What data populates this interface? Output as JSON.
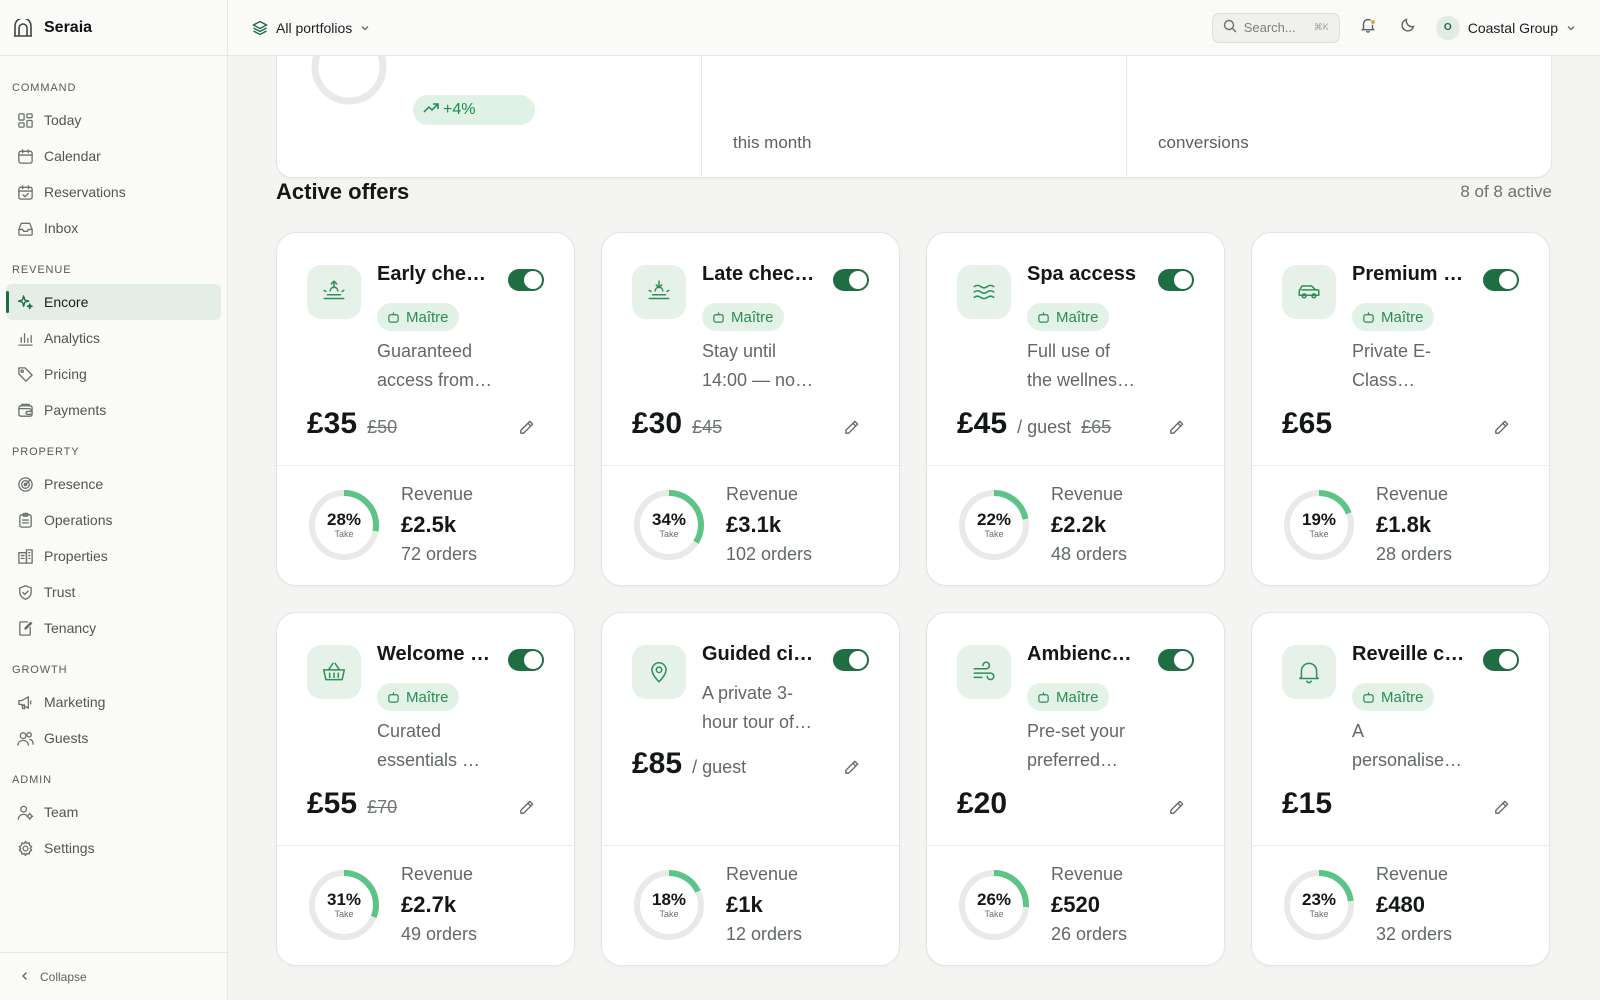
{
  "app": {
    "name": "Seraia"
  },
  "sidebar": {
    "sections": [
      {
        "heading": "COMMAND",
        "items": [
          {
            "label": "Today",
            "icon": "grid-icon"
          },
          {
            "label": "Calendar",
            "icon": "calendar-icon"
          },
          {
            "label": "Reservations",
            "icon": "calendar-check-icon"
          },
          {
            "label": "Inbox",
            "icon": "inbox-icon"
          }
        ]
      },
      {
        "heading": "REVENUE",
        "items": [
          {
            "label": "Encore",
            "icon": "sparkles-icon",
            "active": true
          },
          {
            "label": "Analytics",
            "icon": "bar-chart-icon"
          },
          {
            "label": "Pricing",
            "icon": "tag-icon"
          },
          {
            "label": "Payments",
            "icon": "wallet-icon"
          }
        ]
      },
      {
        "heading": "PROPERTY",
        "items": [
          {
            "label": "Presence",
            "icon": "radar-icon"
          },
          {
            "label": "Operations",
            "icon": "clipboard-icon"
          },
          {
            "label": "Properties",
            "icon": "building-icon"
          },
          {
            "label": "Trust",
            "icon": "shield-icon"
          },
          {
            "label": "Tenancy",
            "icon": "file-edit-icon"
          }
        ]
      },
      {
        "heading": "GROWTH",
        "items": [
          {
            "label": "Marketing",
            "icon": "megaphone-icon"
          },
          {
            "label": "Guests",
            "icon": "users-icon"
          }
        ]
      },
      {
        "heading": "ADMIN",
        "items": [
          {
            "label": "Team",
            "icon": "user-cog-icon"
          },
          {
            "label": "Settings",
            "icon": "gear-icon"
          }
        ]
      }
    ],
    "collapse_label": "Collapse"
  },
  "topbar": {
    "portfolio_label": "All portfolios",
    "search_placeholder": "Search...",
    "search_shortcut": "⌘K",
    "org_initial": "O",
    "org_name": "Coastal Group"
  },
  "stats": {
    "trend": "+4%",
    "labels": [
      "this month",
      "conversions"
    ]
  },
  "offers_section": {
    "title": "Active offers",
    "count": "8 of 8 active"
  },
  "colors": {
    "accent": "#1e6d43",
    "ring": "#5cc487",
    "tag_bg": "#e2f2e7"
  },
  "offers": [
    {
      "name": "Early check-in",
      "icon": "sunrise-icon",
      "tag": "Maître",
      "desc": [
        "Guaranteed",
        "access from…"
      ],
      "price": "£35",
      "per_guest": "",
      "was": "£50",
      "take": "28%",
      "take_label": "Take",
      "take_value": 0.28,
      "revenue_label": "Revenue",
      "revenue": "£2.5k",
      "orders": "72 orders"
    },
    {
      "name": "Late checkout",
      "icon": "sunset-icon",
      "tag": "Maître",
      "desc": [
        "Stay until",
        "14:00 — no…"
      ],
      "price": "£30",
      "per_guest": "",
      "was": "£45",
      "take": "34%",
      "take_label": "Take",
      "take_value": 0.34,
      "revenue_label": "Revenue",
      "revenue": "£3.1k",
      "orders": "102 orders"
    },
    {
      "name": "Spa access",
      "icon": "waves-icon",
      "tag": "Maître",
      "desc": [
        "Full use of",
        "the wellnes…"
      ],
      "price": "£45",
      "per_guest": "/ guest",
      "was": "£65",
      "take": "22%",
      "take_label": "Take",
      "take_value": 0.22,
      "revenue_label": "Revenue",
      "revenue": "£2.2k",
      "orders": "48 orders"
    },
    {
      "name": "Premium transfer",
      "icon": "car-icon",
      "tag": "Maître",
      "desc": [
        "Private E-",
        "Class…"
      ],
      "price": "£65",
      "per_guest": "",
      "was": "",
      "take": "19%",
      "take_label": "Take",
      "take_value": 0.19,
      "revenue_label": "Revenue",
      "revenue": "£1.8k",
      "orders": "28 orders"
    },
    {
      "name": "Welcome basket",
      "icon": "basket-icon",
      "tag": "Maître",
      "desc": [
        "Curated",
        "essentials …"
      ],
      "price": "£55",
      "per_guest": "",
      "was": "£70",
      "take": "31%",
      "take_label": "Take",
      "take_value": 0.31,
      "revenue_label": "Revenue",
      "revenue": "£2.7k",
      "orders": "49 orders"
    },
    {
      "name": "Guided city tour",
      "icon": "map-pin-icon",
      "tag": "",
      "desc": [
        "A private 3-",
        "hour tour of…"
      ],
      "price": "£85",
      "per_guest": "/ guest",
      "was": "",
      "take": "18%",
      "take_label": "Take",
      "take_value": 0.18,
      "revenue_label": "Revenue",
      "revenue": "£1k",
      "orders": "12 orders"
    },
    {
      "name": "Ambience preset",
      "icon": "wind-icon",
      "tag": "Maître",
      "desc": [
        "Pre-set your",
        "preferred…"
      ],
      "price": "£20",
      "per_guest": "",
      "was": "",
      "take": "26%",
      "take_label": "Take",
      "take_value": 0.26,
      "revenue_label": "Revenue",
      "revenue": "£520",
      "orders": "26 orders"
    },
    {
      "name": "Reveille call",
      "icon": "bell-icon",
      "tag": "Maître",
      "desc": [
        "A",
        "personalise…"
      ],
      "price": "£15",
      "per_guest": "",
      "was": "",
      "take": "23%",
      "take_label": "Take",
      "take_value": 0.23,
      "revenue_label": "Revenue",
      "revenue": "£480",
      "orders": "32 orders"
    }
  ]
}
